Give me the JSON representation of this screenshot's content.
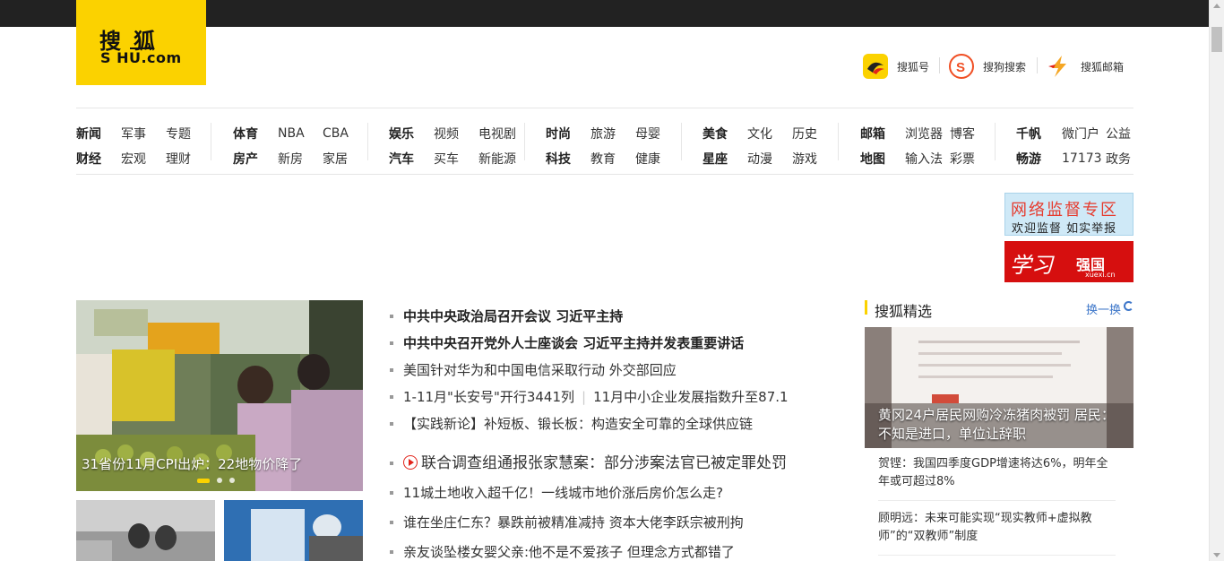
{
  "logo": {
    "cn": "搜狐",
    "en": "S HU.com"
  },
  "quicklinks": [
    {
      "label": "搜狐号",
      "icon": "sohu-hao-icon"
    },
    {
      "label": "搜狗搜索",
      "icon": "sogou-search-icon"
    },
    {
      "label": "搜狐邮箱",
      "icon": "sohu-mail-icon"
    }
  ],
  "nav": {
    "g1": {
      "r1": [
        "新闻",
        "军事",
        "专题"
      ],
      "r2": [
        "财经",
        "宏观",
        "理财"
      ]
    },
    "g2": {
      "r1": [
        "体育",
        "NBA",
        "CBA"
      ],
      "r2": [
        "房产",
        "新房",
        "家居"
      ]
    },
    "g3": {
      "r1": [
        "娱乐",
        "视频",
        "电视剧"
      ],
      "r2": [
        "汽车",
        "买车",
        "新能源"
      ]
    },
    "g4": {
      "r1": [
        "时尚",
        "旅游",
        "母婴"
      ],
      "r2": [
        "科技",
        "教育",
        "健康"
      ]
    },
    "g5": {
      "r1": [
        "美食",
        "文化",
        "历史"
      ],
      "r2": [
        "星座",
        "动漫",
        "游戏"
      ]
    },
    "g6": {
      "r1": [
        "邮箱",
        "浏览器",
        "博客"
      ],
      "r2": [
        "地图",
        "输入法",
        "彩票"
      ]
    },
    "g7": {
      "r1": [
        "千帆",
        "微门户",
        "公益"
      ],
      "r2": [
        "畅游",
        "17173",
        "政务"
      ]
    }
  },
  "ads": {
    "net": {
      "line1": "网络监督专区",
      "line2": "欢迎监督 如实举报"
    },
    "xuexi": {
      "mark": "学习",
      "line1": "强国",
      "line2": "xuexi.cn"
    }
  },
  "hero": {
    "caption": "31省份11月CPI出炉：22地物价降了"
  },
  "news": {
    "top": [
      "中共中央政治局召开会议 习近平主持",
      "中共中央召开党外人士座谈会 习近平主持并发表重要讲话"
    ],
    "item3": "美国针对华为和中国电信采取行动 外交部回应",
    "item4a": "1-11月\"长安号\"开行3441列",
    "item4b": "11月中小企业发展指数升至87.1",
    "item5": "【实践新论】补短板、锻长板：构造安全可靠的全球供应链",
    "item6": "联合调查组通报张家慧案：部分涉案法官已被定罪处罚",
    "item7": "11城土地收入超千亿！一线城市地价涨后房价怎么走?",
    "item8": "谁在坐庄仁东？暴跌前被精准减持 资本大佬李跃宗被刑拘",
    "item9": "亲友谈坠楼女婴父亲:他不是不爱孩子 但理念方式都错了"
  },
  "side": {
    "title": "搜狐精选",
    "refresh": "换一换",
    "img_caption": "黄冈24户居民网购冷冻猪肉被罚 居民：不知是进口，单位让辞职",
    "items": [
      "贺铿：我国四季度GDP增速将达6%，明年全年或可超过8%",
      "顾明远：未来可能实现“现实教师+虚拟教师”的“双教师”制度"
    ]
  },
  "colors": {
    "brand": "#fbd200",
    "link": "#3d76c9",
    "red": "#e2231a"
  }
}
